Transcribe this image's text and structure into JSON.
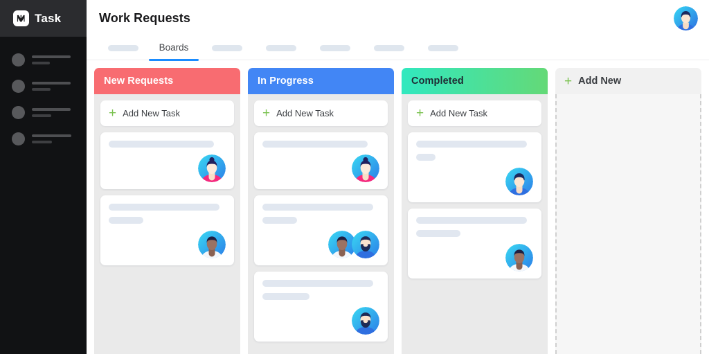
{
  "brand": {
    "name": "Task",
    "mark_icon": "n-logo-icon"
  },
  "sidebar": {
    "items": [
      {
        "icon": "avatar-placeholder-icon",
        "line1_width": 56,
        "line2_width": 26
      },
      {
        "icon": "avatar-placeholder-icon",
        "line1_width": 56,
        "line2_width": 27
      },
      {
        "icon": "avatar-placeholder-icon",
        "line1_width": 56,
        "line2_width": 28
      },
      {
        "icon": "avatar-placeholder-icon",
        "line1_width": 57,
        "line2_width": 29
      }
    ]
  },
  "header": {
    "title": "Work Requests",
    "user_avatar": "user-avatar"
  },
  "tabs": {
    "items": [
      {
        "type": "placeholder",
        "label": "",
        "active": false,
        "width": 44
      },
      {
        "type": "label",
        "label": "Boards",
        "active": true
      },
      {
        "type": "placeholder",
        "label": "",
        "active": false,
        "width": 44
      },
      {
        "type": "placeholder",
        "label": "",
        "active": false,
        "width": 44
      },
      {
        "type": "placeholder",
        "label": "",
        "active": false,
        "width": 44
      },
      {
        "type": "placeholder",
        "label": "",
        "active": false,
        "width": 44
      },
      {
        "type": "placeholder",
        "label": "",
        "active": false,
        "width": 44
      }
    ],
    "active_indicator_color": "#1a8cff"
  },
  "board": {
    "add_task_label": "Add New Task",
    "columns": [
      {
        "title": "New Requests",
        "header_color": "#f86c71",
        "header_text_color": "#ffffff",
        "cards": [
          {
            "bars": [
              182
            ],
            "avatars": [
              "female-bun-pink"
            ]
          },
          {
            "bars": [
              182,
              62
            ],
            "avatars": [
              "male-dark-skin"
            ]
          }
        ]
      },
      {
        "title": "In Progress",
        "header_color": "#4286f5",
        "header_text_color": "#ffffff",
        "cards": [
          {
            "bars": [
              178
            ],
            "avatars": [
              "female-bun-pink"
            ]
          },
          {
            "bars": [
              182,
              62
            ],
            "avatars": [
              "male-dark-skin",
              "male-beard"
            ]
          },
          {
            "bars": [
              182,
              78
            ],
            "avatars": [
              "male-beard"
            ]
          }
        ]
      },
      {
        "title": "Completed",
        "header_color_start": "#31e8bf",
        "header_color_end": "#64d977",
        "header_text_color": "#1f2a33",
        "cards": [
          {
            "bars": [
              160,
              34
            ],
            "avatars": [
              "male-blue-shirt"
            ]
          },
          {
            "bars": [
              160,
              72
            ],
            "avatars": [
              "male-dark-skin"
            ]
          }
        ]
      }
    ],
    "add_new_column": {
      "label": "Add New",
      "plus_icon": "plus-icon",
      "plus_color": "#7ac24f"
    }
  }
}
